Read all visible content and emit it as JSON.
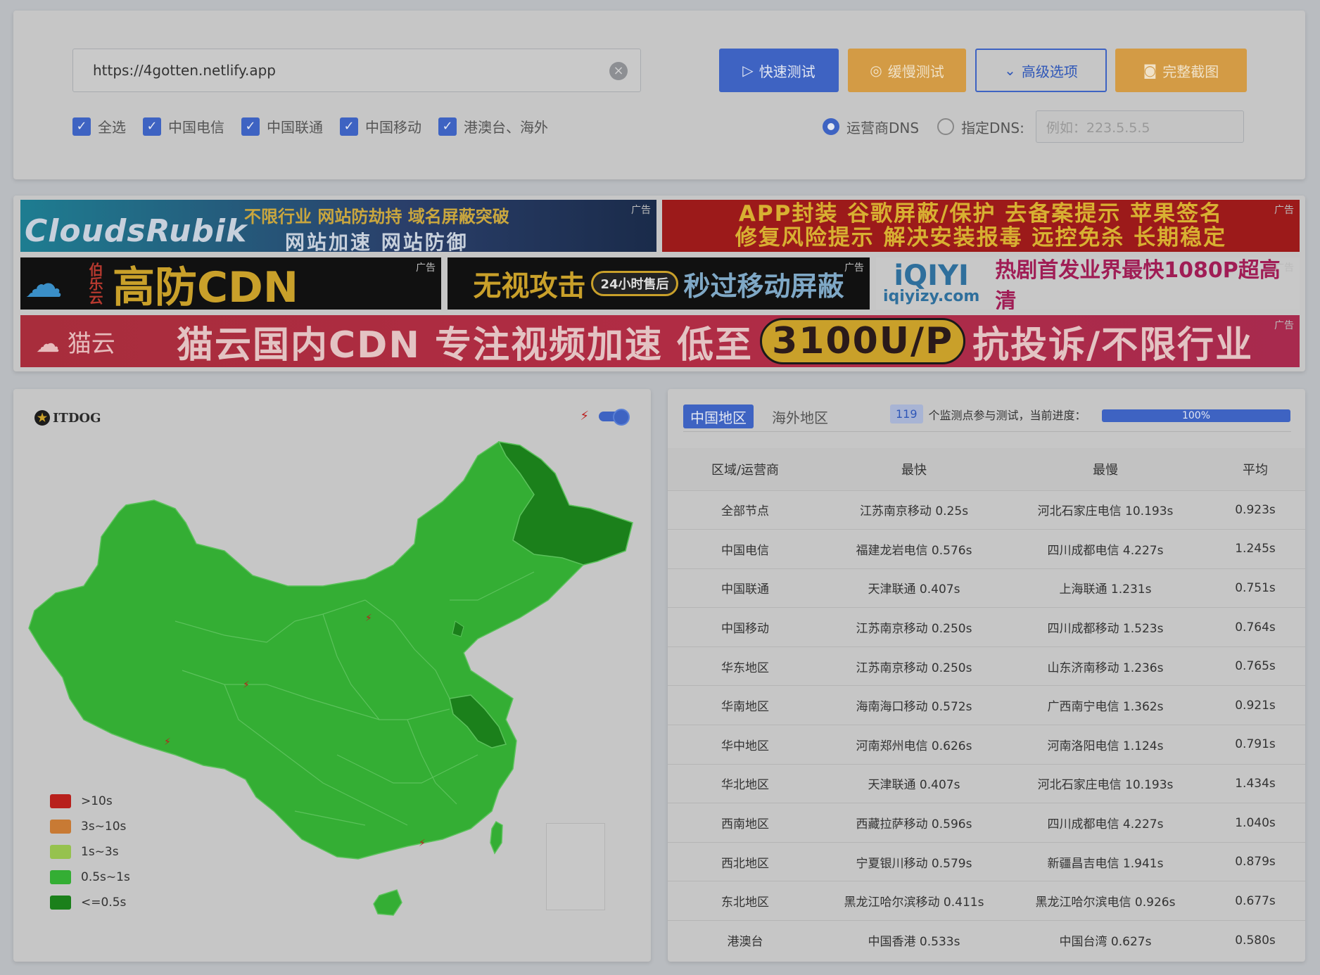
{
  "top": {
    "url_value": "https://4gotten.netlify.app",
    "clear_icon": "×",
    "buttons": {
      "quick": "快速测试",
      "slow": "缓慢测试",
      "advanced": "高级选项",
      "screenshot": "完整截图"
    },
    "checks": [
      "全选",
      "中国电信",
      "中国联通",
      "中国移动",
      "港澳台、海外"
    ],
    "radio_isp": "运营商DNS",
    "radio_custom": "指定DNS:",
    "dns_placeholder": "例如：223.5.5.5"
  },
  "ads": {
    "tag": "广告",
    "ad1": {
      "logo": "CloudsRubik",
      "line1": "不限行业  网站防劫持  域名屏蔽突破",
      "line2": "网站加速  网站防御"
    },
    "ad2": {
      "line1": "APP封装 谷歌屏蔽/保护 去备案提示 苹果签名",
      "line2": "修复风险提示 解决安装报毒 远控免杀 长期稳定"
    },
    "ad3": {
      "brand": "伯乐云",
      "title": "高防CDN"
    },
    "ad4": {
      "left": "无视攻击",
      "pill": "24小时售后",
      "right": "秒过移动屏蔽"
    },
    "ad5": {
      "brand": "iQIYI",
      "site": "iqiyizy.com",
      "text": "热剧首发业界最快1080P超高清"
    },
    "ad6": {
      "brand": "猫云",
      "text": "猫云国内CDN 专注视频加速 低至",
      "price": "3100U/P",
      "tail": "抗投诉/不限行业"
    }
  },
  "map": {
    "logo": "ITDOG",
    "legend": [
      {
        "label": ">10s",
        "color": "#b8201c"
      },
      {
        "label": "3s~10s",
        "color": "#c87a34"
      },
      {
        "label": "1s~3s",
        "color": "#96c24e"
      },
      {
        "label": "0.5s~1s",
        "color": "#34ae34"
      },
      {
        "label": "<=0.5s",
        "color": "#1b801b"
      }
    ]
  },
  "stats": {
    "tab_china": "中国地区",
    "tab_overseas": "海外地区",
    "monitor_count": "119",
    "progress_label": "个监测点参与测试，当前进度：",
    "progress": "100%",
    "progress_fraction": 1.0,
    "headers": [
      "区域/运营商",
      "最快",
      "最慢",
      "平均"
    ],
    "rows": [
      [
        "全部节点",
        "江苏南京移动 0.25s",
        "河北石家庄电信 10.193s",
        "0.923s"
      ],
      [
        "中国电信",
        "福建龙岩电信 0.576s",
        "四川成都电信 4.227s",
        "1.245s"
      ],
      [
        "中国联通",
        "天津联通 0.407s",
        "上海联通 1.231s",
        "0.751s"
      ],
      [
        "中国移动",
        "江苏南京移动 0.250s",
        "四川成都移动 1.523s",
        "0.764s"
      ],
      [
        "华东地区",
        "江苏南京移动 0.250s",
        "山东济南移动 1.236s",
        "0.765s"
      ],
      [
        "华南地区",
        "海南海口移动 0.572s",
        "广西南宁电信 1.362s",
        "0.921s"
      ],
      [
        "华中地区",
        "河南郑州电信 0.626s",
        "河南洛阳电信 1.124s",
        "0.791s"
      ],
      [
        "华北地区",
        "天津联通 0.407s",
        "河北石家庄电信 10.193s",
        "1.434s"
      ],
      [
        "西南地区",
        "西藏拉萨移动 0.596s",
        "四川成都电信 4.227s",
        "1.040s"
      ],
      [
        "西北地区",
        "宁夏银川移动 0.579s",
        "新疆昌吉电信 1.941s",
        "0.879s"
      ],
      [
        "东北地区",
        "黑龙江哈尔滨移动 0.411s",
        "黑龙江哈尔滨电信 0.926s",
        "0.677s"
      ],
      [
        "港澳台",
        "中国香港 0.533s",
        "中国台湾 0.627s",
        "0.580s"
      ]
    ]
  }
}
